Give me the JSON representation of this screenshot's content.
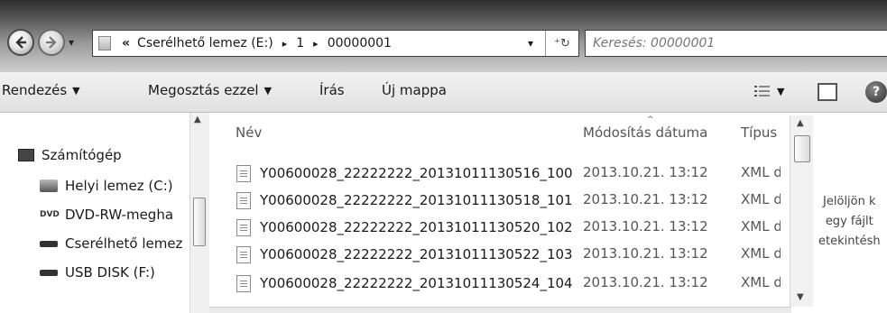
{
  "address": {
    "overflow_glyph": "«",
    "crumbs": [
      "Cserélhető lemez (E:)",
      "1",
      "00000001"
    ],
    "separator": "▸",
    "dropdown": "▾",
    "refresh": "⁺↻"
  },
  "search": {
    "placeholder": "Keresés: 00000001",
    "icon": "search-icon"
  },
  "toolbar": {
    "organize": "Rendezés",
    "share": "Megosztás ezzel",
    "burn": "Írás",
    "new_folder": "Új mappa"
  },
  "nav": {
    "computer": "Számítógép",
    "items": [
      "Helyi lemez (C:)",
      "DVD-RW-megha",
      "Cserélhető lemez",
      "USB DISK (F:)"
    ]
  },
  "columns": {
    "name": "Név",
    "date": "Módosítás dátuma",
    "type": "Típus"
  },
  "files": [
    {
      "name": "Y00600028_22222222_20131011130516_100",
      "date": "2013.10.21. 13:12",
      "type": "XML do"
    },
    {
      "name": "Y00600028_22222222_20131011130518_101",
      "date": "2013.10.21. 13:12",
      "type": "XML do"
    },
    {
      "name": "Y00600028_22222222_20131011130520_102",
      "date": "2013.10.21. 13:12",
      "type": "XML do"
    },
    {
      "name": "Y00600028_22222222_20131011130522_103",
      "date": "2013.10.21. 13:12",
      "type": "XML do"
    },
    {
      "name": "Y00600028_22222222_20131011130524_104",
      "date": "2013.10.21. 13:12",
      "type": "XML do"
    }
  ],
  "preview": {
    "lines": [
      "Jelöljön k",
      "egy fájlt",
      "etekintésh"
    ]
  }
}
